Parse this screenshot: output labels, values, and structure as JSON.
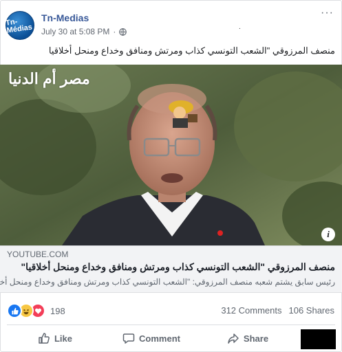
{
  "post": {
    "page_name": "Tn-Medias",
    "avatar_text": "Tn-Médias",
    "timestamp": "July 30 at 5:08 PM",
    "separator": "·",
    "stray_mark": ".",
    "caption": "منصف المرزوقي \"الشعب التونسي كذاب ومرتش ومنافق وخداع ومنحل أخلاقيا"
  },
  "video": {
    "watermark": "مصر أم الدنيا",
    "info_badge": "i"
  },
  "link": {
    "domain": "YOUTUBE.COM",
    "title": "منصف المرزوقي \"الشعب التونسي كذاب ومرتش ومنافق وخداع ومنحل أخلاقيا\"",
    "description": "رئيس سابق يشتم شعبه منصف المرزوقي: \"الشعب التونسي كذاب ومرتش ومنافق وخداع ومنحل أخلاقيا"
  },
  "engagement": {
    "reaction_count": "198",
    "comments": "312 Comments",
    "shares": "106 Shares",
    "reactions": [
      "like-icon",
      "haha-icon",
      "love-icon"
    ]
  },
  "actions": {
    "like": "Like",
    "comment": "Comment",
    "share": "Share"
  },
  "colors": {
    "link_blue": "#385898",
    "like_blue": "#1877f2",
    "love_red": "#f33e58",
    "haha_yellow": "#f7c744"
  }
}
